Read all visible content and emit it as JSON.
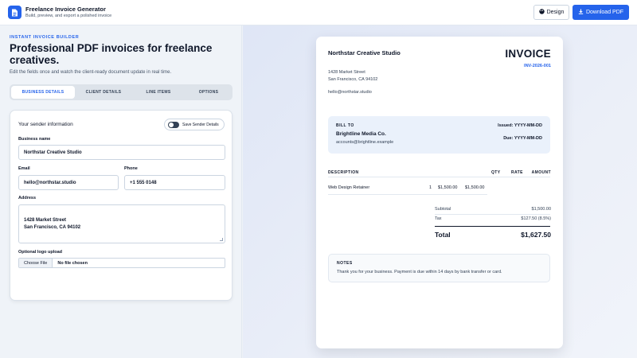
{
  "header": {
    "app_title": "Freelance Invoice Generator",
    "app_subtitle": "Build, preview, and export a polished invoice",
    "logo_icon": "document-icon",
    "design_label": "Design",
    "design_icon": "palette-icon",
    "download_label": "Download PDF",
    "download_icon": "download-icon"
  },
  "builder": {
    "eyebrow": "INSTANT INVOICE BUILDER",
    "headline": "Professional PDF invoices for freelance creatives.",
    "lede": "Edit the fields once and watch the client-ready document update in real time.",
    "tabs": [
      {
        "label": "BUSINESS DETAILS",
        "active": true
      },
      {
        "label": "CLIENT DETAILS",
        "active": false
      },
      {
        "label": "LINE ITEMS",
        "active": false
      },
      {
        "label": "OPTIONS",
        "active": false
      }
    ],
    "form": {
      "section_title": "Your sender information",
      "save_toggle_label": "Save Sender Details",
      "business_name_label": "Business name",
      "business_name_value": "Northstar Creative Studio",
      "email_label": "Email",
      "email_value": "hello@northstar.studio",
      "phone_label": "Phone",
      "phone_value": "+1 555 0148",
      "address_label": "Address",
      "address_value": "1428 Market Street\nSan Francisco, CA 94102",
      "logo_label": "Optional logo upload",
      "choose_file_label": "Choose File",
      "file_status": "No file chosen"
    }
  },
  "invoice": {
    "sender_name": "Northstar Creative Studio",
    "sender_address": "1428 Market Street\nSan Francisco, CA 94102",
    "sender_email": "hello@northstar.studio",
    "title": "INVOICE",
    "number": "INV-2026-001",
    "bill_to_label": "BILL TO",
    "client_name": "Brightline Media Co.",
    "client_email": "accounts@brightline.example",
    "issued": "Issued: YYYY-MM-DD",
    "due": "Due: YYYY-MM-DD",
    "columns": {
      "description": "DESCRIPTION",
      "qty": "QTY",
      "rate": "RATE",
      "amount": "AMOUNT"
    },
    "items": [
      {
        "description": "Web Design Retainer",
        "qty": "1",
        "rate": "$1,500.00",
        "amount": "$1,500.00"
      }
    ],
    "subtotal_label": "Subtotal",
    "subtotal_value": "$1,500.00",
    "tax_label": "Tax",
    "tax_value": "$127.50 (8.5%)",
    "total_label": "Total",
    "total_value": "$1,627.50",
    "notes_label": "NOTES",
    "notes_text": "Thank you for your business. Payment is due within 14 days by bank transfer or card."
  },
  "colors": {
    "accent": "#2563eb",
    "text": "#0f172a",
    "muted": "#475569"
  }
}
